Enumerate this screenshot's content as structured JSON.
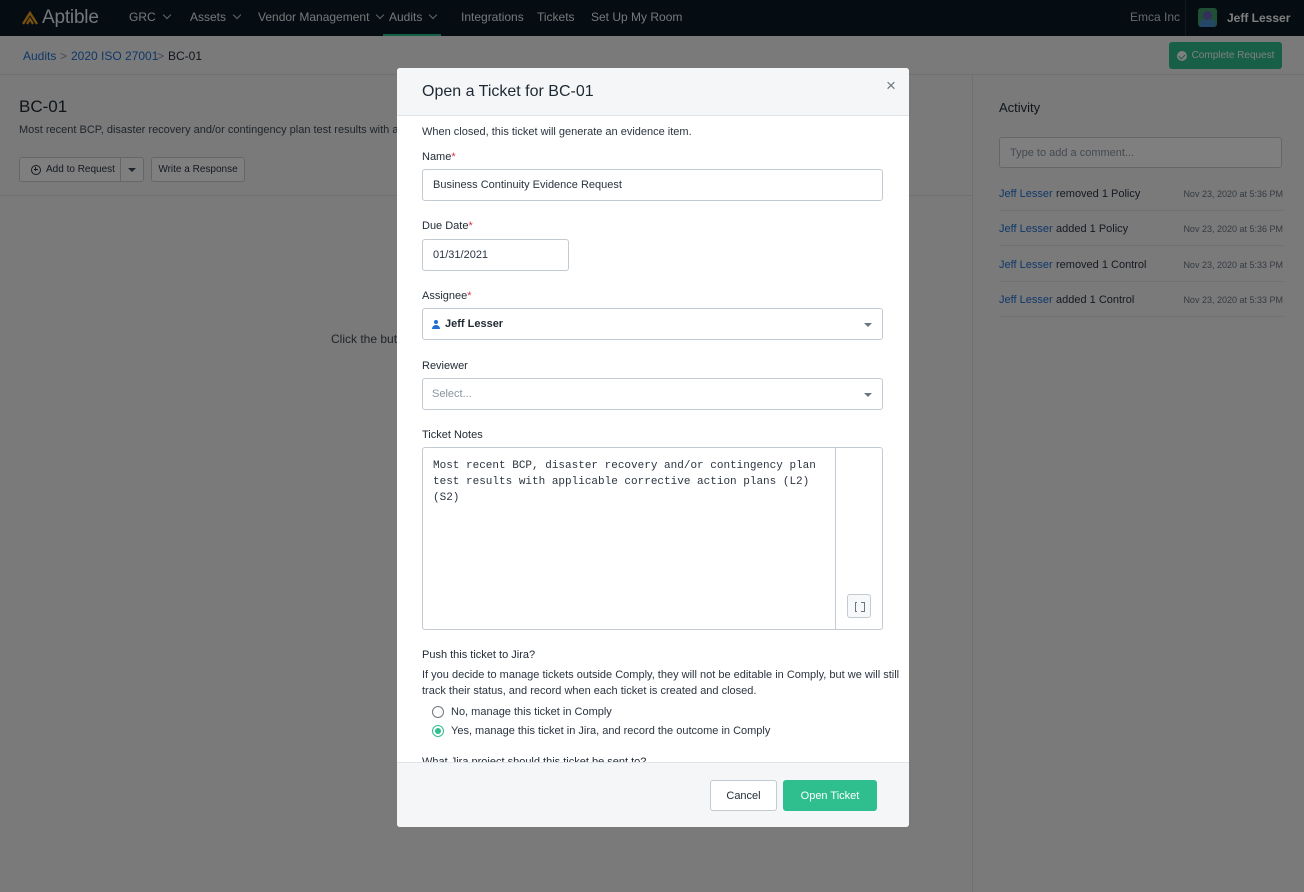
{
  "nav": {
    "brand": "Aptible",
    "items": [
      {
        "label": "GRC"
      },
      {
        "label": "Assets"
      },
      {
        "label": "Vendor Management"
      },
      {
        "label": "Audits"
      },
      {
        "label": "Integrations"
      },
      {
        "label": "Tickets"
      },
      {
        "label": "Set Up My Room"
      }
    ],
    "active_item": "Audits",
    "org": "Emca Inc",
    "user": "Jeff Lesser"
  },
  "breadcrumb": {
    "items": [
      "Audits",
      "2020 ISO 27001",
      "BC-01"
    ],
    "separator": ">"
  },
  "header_actions": {
    "complete_label": "Complete Request"
  },
  "page": {
    "title": "BC-01",
    "description": "Most recent BCP, disaster recovery and/or contingency plan test results with app",
    "add_to_request": "Add to Request",
    "write_response": "Write a Response",
    "empty_text": "Click the butto"
  },
  "activity": {
    "title": "Activity",
    "comment_placeholder": "Type to add a comment...",
    "entries": [
      {
        "user": "Jeff Lesser",
        "action": "removed 1 Policy",
        "time": "Nov 23, 2020 at 5:36 PM"
      },
      {
        "user": "Jeff Lesser",
        "action": "added 1 Policy",
        "time": "Nov 23, 2020 at 5:36 PM"
      },
      {
        "user": "Jeff Lesser",
        "action": "removed 1 Control",
        "time": "Nov 23, 2020 at 5:33 PM"
      },
      {
        "user": "Jeff Lesser",
        "action": "added 1 Control",
        "time": "Nov 23, 2020 at 5:33 PM"
      }
    ]
  },
  "modal": {
    "title": "Open a Ticket for BC-01",
    "close_glyph": "×",
    "intro": "When closed, this ticket will generate an evidence item.",
    "required_mark": "*",
    "name_label": "Name",
    "name_value": "Business Continuity Evidence Request",
    "due_label": "Due Date",
    "due_value": "01/31/2021",
    "assignee_label": "Assignee",
    "assignee_value": "Jeff Lesser",
    "reviewer_label": "Reviewer",
    "reviewer_placeholder": "Select...",
    "notes_label": "Ticket Notes",
    "notes_value": "Most recent BCP, disaster recovery and/or contingency plan test results with applicable corrective action plans (L2)(S2)",
    "jira_label": "Push this ticket to Jira?",
    "jira_help_1": "If you decide to manage tickets outside Comply, they will not be editable in Comply, but we will still",
    "jira_help_2": "track their status, and record when each ticket is created and closed.",
    "jira_option_no": "No, manage this ticket in Comply",
    "jira_option_yes": "Yes, manage this ticket in Jira, and record the outcome in Comply",
    "jira_selected": "yes",
    "jira_project_label": "What Jira project should this ticket be sent to?",
    "cancel_label": "Cancel",
    "submit_label": "Open Ticket"
  },
  "colors": {
    "nav_bg": "#0b1a24",
    "accent_green": "#2fbf8f",
    "link_blue": "#1f6fd1",
    "required_red": "#d6334a"
  }
}
